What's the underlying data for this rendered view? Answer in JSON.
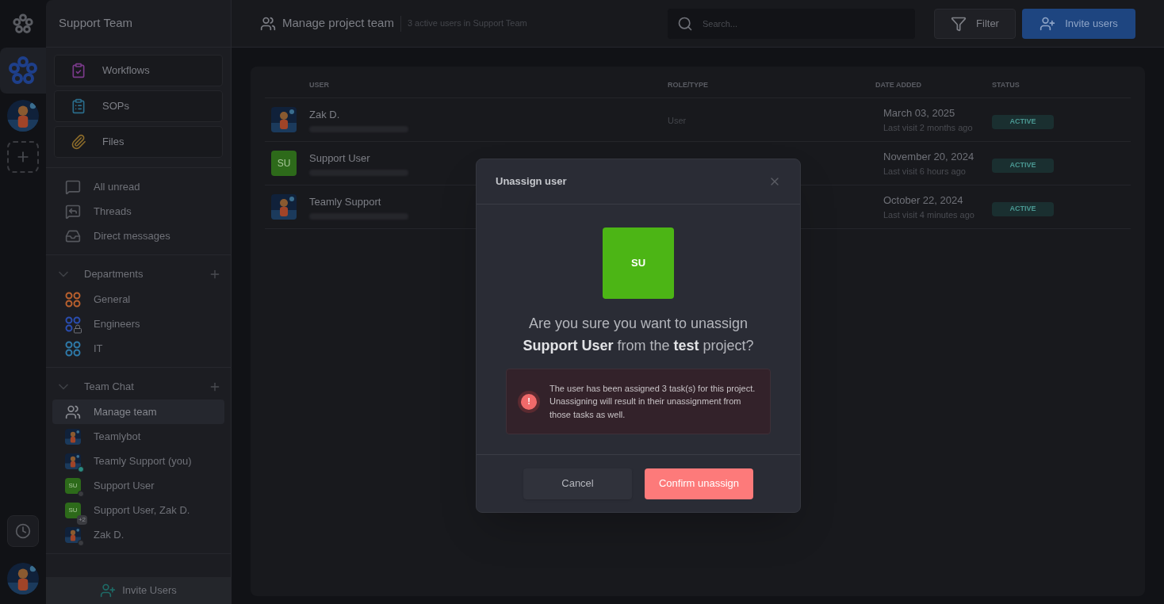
{
  "sidebar": {
    "team_name": "Support Team",
    "shortcuts": [
      {
        "label": "Workflows",
        "kind": "workflows"
      },
      {
        "label": "SOPs",
        "kind": "sops"
      },
      {
        "label": "Files",
        "kind": "files"
      }
    ],
    "inbox": [
      {
        "label": "All unread",
        "kind": "unread"
      },
      {
        "label": "Threads",
        "kind": "threads"
      },
      {
        "label": "Direct messages",
        "kind": "direct"
      }
    ],
    "departments": {
      "title": "Departments",
      "expanded": true,
      "items": [
        {
          "label": "General",
          "color": "#b8602e",
          "locked": false
        },
        {
          "label": "Engineers",
          "color": "#2a4db0",
          "locked": true
        },
        {
          "label": "IT",
          "color": "#2e79a8",
          "locked": false
        }
      ]
    },
    "team_chat": {
      "title": "Team Chat",
      "expanded": true,
      "items": [
        {
          "label": "Manage team",
          "kind": "team",
          "selected": true
        },
        {
          "label": "Teamlybot",
          "kind": "picture",
          "selected": false
        },
        {
          "label": "Teamly Support (you)",
          "kind": "picture",
          "selected": false,
          "online": true
        },
        {
          "label": "Support User",
          "kind": "initials",
          "initials": "SU",
          "selected": false,
          "online": false
        },
        {
          "label": "Support User, Zak D.",
          "kind": "initials",
          "initials": "SU",
          "badge": "+2",
          "selected": false
        },
        {
          "label": "Zak D.",
          "kind": "picture",
          "selected": false,
          "online": false
        }
      ]
    },
    "invite_button": "Invite Users"
  },
  "header": {
    "title": "Manage project team",
    "subtitle": "3 active users in Support Team",
    "search": {
      "placeholder": "Search..."
    },
    "filter_button": "Filter",
    "invite_button": "Invite users"
  },
  "table": {
    "columns": [
      "USER",
      "ROLE/TYPE",
      "DATE ADDED",
      "STATUS"
    ],
    "rows": [
      {
        "name": "Zak D.",
        "kind": "picture",
        "role": "User",
        "date": "March 03, 2025",
        "last_visit": "Last visit 2 months ago",
        "status": "ACTIVE"
      },
      {
        "name": "Support User",
        "kind": "initials",
        "initials": "SU",
        "date": "November 20, 2024",
        "last_visit": "Last visit 6 hours ago",
        "status": "ACTIVE"
      },
      {
        "name": "Teamly Support",
        "kind": "picture",
        "date": "October 22, 2024",
        "last_visit": "Last visit 4 minutes ago",
        "status": "ACTIVE"
      }
    ]
  },
  "dialog": {
    "title": "Unassign user",
    "avatar_initials": "SU",
    "alert_symbol": "!",
    "question": "Are you sure you want to unassign **Support User** from the **test** project?",
    "warning": "The user has been assigned 3 task(s) for this project. Unassigning will result in their unassignment from those tasks as well.",
    "cancel_button": "Cancel",
    "confirm_button": "Confirm unassign"
  }
}
